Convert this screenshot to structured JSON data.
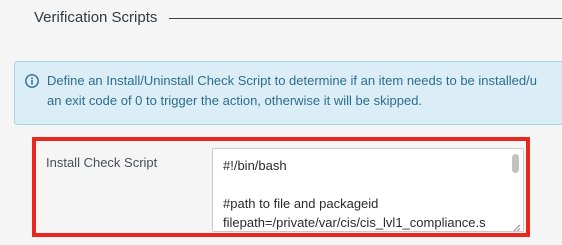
{
  "section": {
    "title": "Verification Scripts"
  },
  "info": {
    "icon": "info-circle-icon",
    "line1": "Define an Install/Uninstall Check Script to determine if an item needs to be installed/u",
    "line2": "an exit code of 0 to trigger the action, otherwise it will be skipped."
  },
  "install_check": {
    "label": "Install Check Script",
    "script_lines": "#!/bin/bash\n\n#path to file and packageid\nfilepath=/private/var/cis/cis_lvl1_compliance.s"
  },
  "colors": {
    "highlight_border": "#e8281f",
    "info_background": "#dbeef7",
    "info_text": "#2d6d8c"
  }
}
